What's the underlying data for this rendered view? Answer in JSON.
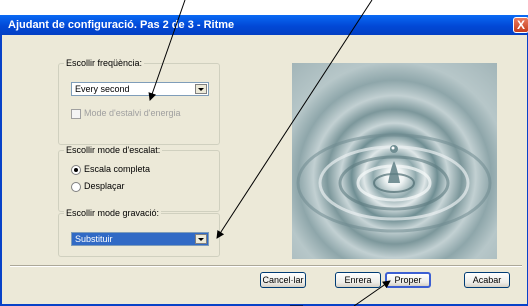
{
  "window": {
    "title": "Ajudant de configuració. Pas 2 de 3 - Ritme",
    "close_glyph": "X"
  },
  "frequency": {
    "legend": "Escollir freqüència:",
    "selected": "Every second",
    "checkbox_label": "Mode d'estalvi d'energia",
    "checkbox_checked": false,
    "checkbox_enabled": false
  },
  "scale": {
    "legend": "Escollir mode d'escalat:",
    "options": [
      "Escala completa",
      "Desplaçar"
    ],
    "selected_index": 0
  },
  "record": {
    "legend": "Escollir mode gravació:",
    "selected": "Substituir"
  },
  "image": {
    "icon": "water-drop-photo"
  },
  "buttons": {
    "cancel": "Cancel·lar",
    "back": "Enrera",
    "next": "Proper",
    "finish": "Acabar"
  },
  "colors": {
    "title_bar": "#0a5fe8",
    "selection": "#316ac5",
    "face": "#ece9d8"
  }
}
